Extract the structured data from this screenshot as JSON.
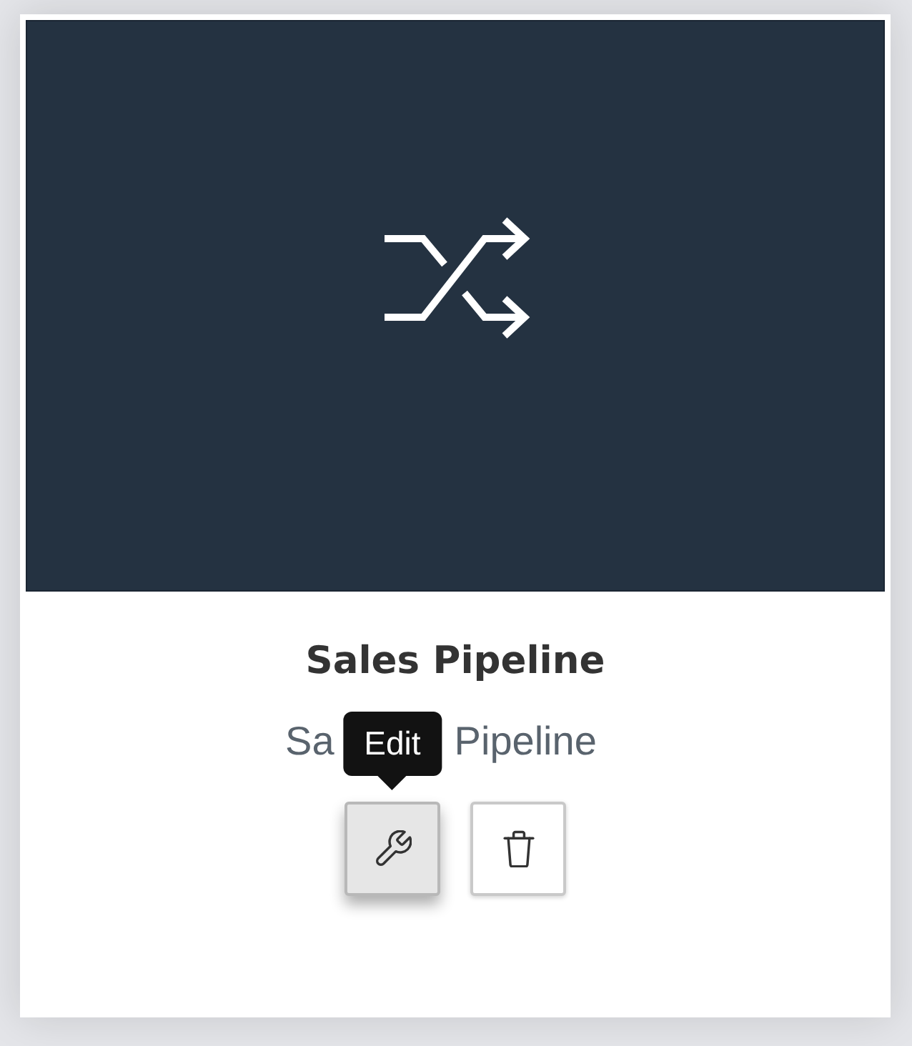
{
  "card": {
    "title": "Sales Pipeline",
    "subtitle_parts": [
      "Sa",
      "Pipeline"
    ],
    "buttons": [
      {
        "kind": "edit",
        "hovered": true,
        "tooltip": "Edit"
      },
      {
        "kind": "delete",
        "hovered": false
      }
    ]
  }
}
